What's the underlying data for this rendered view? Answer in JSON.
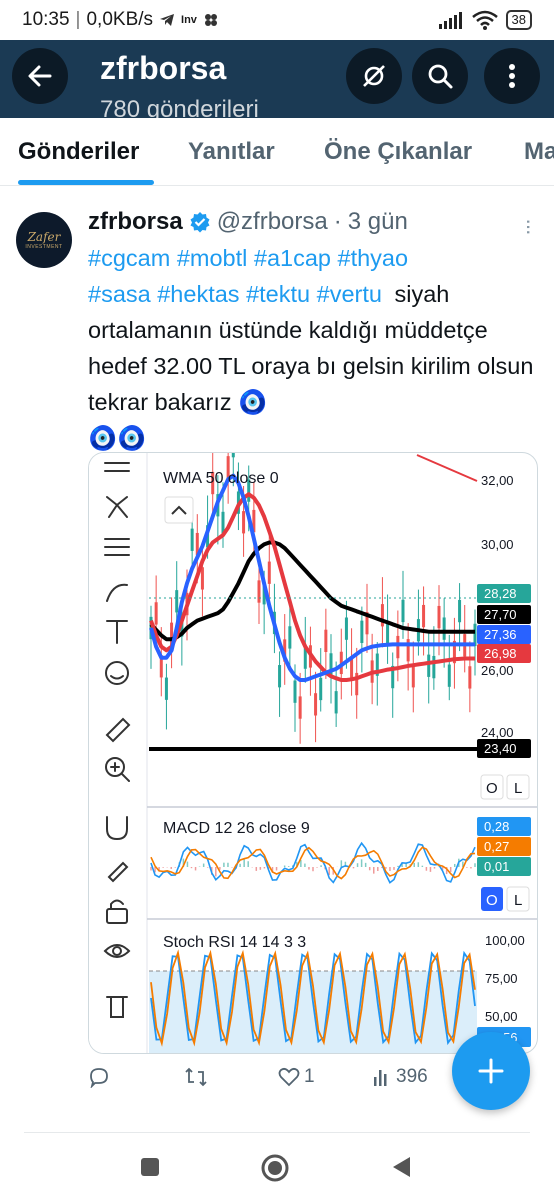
{
  "status_bar": {
    "time": "10:35",
    "net_speed": "0,0KB/s",
    "battery": "38",
    "notif_icons": [
      "telegram-icon",
      "investing-icon",
      "clover-icon"
    ]
  },
  "header": {
    "title": "zfrborsa",
    "subtitle": "780 gönderileri",
    "bg_color": "#1b3a54"
  },
  "tabs": [
    {
      "label": "Gönderiler",
      "active": true
    },
    {
      "label": "Yanıtlar",
      "active": false
    },
    {
      "label": "Öne Çıkanlar",
      "active": false
    },
    {
      "label": "Ma",
      "active": false
    }
  ],
  "post": {
    "display_name": "zfrborsa",
    "verified": true,
    "handle": "@zfrborsa",
    "separator": "·",
    "age": "3 gün",
    "avatar_text": "Zafer",
    "avatar_subtext": "INVESTMENT",
    "hashtags_line1": "#cgcam #mobtl #a1cap #thyao",
    "hashtags_line2": "#sasa #hektas #tektu #vertu",
    "text_after_tags": "siyah ortalamanın üstünde kaldığı müddetçe hedef 32.00 TL oraya bı gelsin kirilim olsun tekrar bakarız",
    "emoji_inline": "🧿",
    "emoji_line": "🧿🧿"
  },
  "chart_panel": {
    "main_label": "WMA 50 close 0",
    "macd_label": "MACD 12 26 close 9",
    "rsi_label": "Stoch RSI 14 14 3 3",
    "price_ticks": [
      "32,00",
      "30,00",
      "24,00"
    ],
    "price_tag_hidden": "26,00",
    "price_tags": [
      {
        "value": "28,28",
        "color": "#26a69a"
      },
      {
        "value": "27,70",
        "color": "#000000"
      },
      {
        "value": "27,36",
        "color": "#2962ff"
      },
      {
        "value": "26,98",
        "color": "#e5393f"
      },
      {
        "value": "23,40",
        "color": "#000000"
      }
    ],
    "macd_tags": [
      {
        "value": "0,28",
        "color": "#2196f3"
      },
      {
        "value": "0,27",
        "color": "#f57c00"
      },
      {
        "value": "0,01",
        "color": "#26a69a"
      }
    ],
    "rsi_ticks": [
      "100,00",
      "75,00",
      "50,00"
    ],
    "rsi_tag": "20,56",
    "btn_o": "O",
    "btn_l": "L",
    "toolbar_icons": [
      "menu-lines-icon",
      "node-tool-icon",
      "fib-tool-icon",
      "brush-icon",
      "text-tool-icon",
      "emoji-icon",
      "ruler-icon",
      "zoom-in-icon",
      "magnet-icon",
      "lock-pencil-icon",
      "unlock-icon",
      "eye-icon",
      "trash-icon"
    ],
    "chart_data": {
      "type": "line",
      "title": "WMA 50 close 0",
      "ylabel": "",
      "ylim": [
        23.2,
        32.4
      ],
      "x": [
        0,
        1,
        2,
        3,
        4,
        5,
        6,
        7,
        8,
        9,
        10,
        11,
        12,
        13,
        14,
        15,
        16,
        17,
        18,
        19,
        20,
        21,
        22,
        23,
        24,
        25,
        26,
        27,
        28,
        29,
        30,
        31,
        32,
        33,
        34,
        35,
        36,
        37,
        38,
        39,
        40,
        41,
        42,
        43,
        44,
        45,
        46,
        47,
        48,
        49,
        50,
        51,
        52,
        53,
        54,
        55,
        56,
        57,
        58,
        59,
        60,
        61,
        62,
        63
      ],
      "series": [
        {
          "name": "",
          "color": "#000000",
          "values": [
            27.9,
            27.75,
            27.6,
            27.5,
            27.5,
            27.55,
            27.65,
            27.8,
            27.9,
            28.0,
            28.05,
            28.1,
            28.15,
            28.2,
            28.3,
            28.5,
            28.75,
            29.0,
            29.3,
            29.6,
            29.8,
            29.95,
            30.05,
            30.1,
            30.1,
            30.05,
            29.95,
            29.8,
            29.65,
            29.5,
            29.35,
            29.2,
            29.05,
            28.9,
            28.75,
            28.6,
            28.5,
            28.4,
            28.35,
            28.3,
            28.25,
            28.2,
            28.15,
            28.1,
            28.05,
            28.0,
            27.95,
            27.9,
            27.85,
            27.8,
            27.78,
            27.76,
            27.74,
            27.72,
            27.7,
            27.7,
            27.7,
            27.7,
            27.7,
            27.7,
            27.7,
            27.7,
            27.7,
            27.7
          ]
        },
        {
          "name": "",
          "color": "#e5393f",
          "values": [
            28.0,
            27.6,
            27.3,
            27.2,
            27.3,
            27.6,
            28.0,
            28.4,
            28.8,
            29.2,
            29.6,
            29.9,
            30.1,
            30.2,
            30.3,
            30.5,
            30.8,
            31.1,
            31.3,
            31.4,
            31.3,
            31.1,
            30.8,
            30.4,
            30.0,
            29.5,
            29.0,
            28.5,
            28.0,
            27.6,
            27.3,
            27.1,
            26.9,
            26.75,
            26.6,
            26.5,
            26.45,
            26.4,
            26.4,
            26.42,
            26.45,
            26.5,
            26.55,
            26.6,
            26.62,
            26.65,
            26.68,
            26.7,
            26.72,
            26.75,
            26.78,
            26.8,
            26.82,
            26.84,
            26.86,
            26.88,
            26.9,
            26.92,
            26.94,
            26.96,
            26.97,
            26.98,
            26.98,
            26.98
          ]
        },
        {
          "name": "",
          "color": "#2962ff",
          "values": [
            27.8,
            27.3,
            27.0,
            27.0,
            27.2,
            27.8,
            28.5,
            29.0,
            29.4,
            29.7,
            30.0,
            30.4,
            30.8,
            31.2,
            31.5,
            31.8,
            31.9,
            31.7,
            31.3,
            30.8,
            30.2,
            29.6,
            29.0,
            28.4,
            27.9,
            27.4,
            27.0,
            26.7,
            26.5,
            26.4,
            26.4,
            26.45,
            26.5,
            26.55,
            26.6,
            26.65,
            26.7,
            26.8,
            26.9,
            27.0,
            27.1,
            27.2,
            27.25,
            27.3,
            27.32,
            27.34,
            27.35,
            27.36,
            27.36,
            27.36,
            27.36,
            27.36,
            27.36,
            27.36,
            27.36,
            27.36,
            27.36,
            27.36,
            27.36,
            27.36,
            27.36,
            27.36,
            27.36,
            27.36
          ]
        }
      ]
    }
  },
  "actions": {
    "likes": "1",
    "views": "396"
  }
}
